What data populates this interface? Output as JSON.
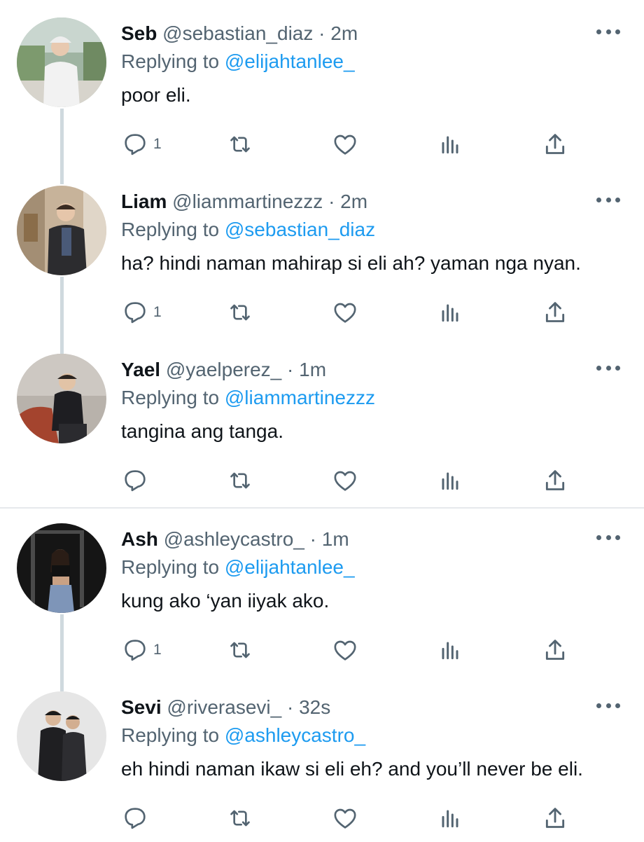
{
  "tweets": [
    {
      "name": "Seb",
      "handle": "@sebastian_diaz",
      "dot": "·",
      "time": "2m",
      "replying_prefix": "Replying to",
      "replying_handle": "@elijahtanlee_",
      "text": "poor eli.",
      "reply_count": "1",
      "avatar_icon": "profile-photo"
    },
    {
      "name": "Liam",
      "handle": "@liammartinezzz",
      "dot": "·",
      "time": "2m",
      "replying_prefix": "Replying to",
      "replying_handle": "@sebastian_diaz",
      "text": "ha? hindi naman mahirap si eli ah? yaman nga nyan.",
      "reply_count": "1",
      "avatar_icon": "profile-photo"
    },
    {
      "name": "Yael",
      "handle": "@yaelperez_",
      "dot": "·",
      "time": "1m",
      "replying_prefix": "Replying to",
      "replying_handle": "@liammartinezzz",
      "text": "tangina ang tanga.",
      "reply_count": "",
      "avatar_icon": "profile-photo"
    },
    {
      "name": "Ash",
      "handle": "@ashleycastro_",
      "dot": "·",
      "time": "1m",
      "replying_prefix": "Replying to",
      "replying_handle": "@elijahtanlee_",
      "text": "kung ako ‘yan iiyak ako.",
      "reply_count": "1",
      "avatar_icon": "profile-photo"
    },
    {
      "name": "Sevi",
      "handle": "@riverasevi_",
      "dot": "·",
      "time": "32s",
      "replying_prefix": "Replying to",
      "replying_handle": "@ashleycastro_",
      "text": "eh hindi naman ikaw si eli eh? and you’ll never be eli.",
      "reply_count": "",
      "avatar_icon": "profile-photo"
    }
  ],
  "icons": {
    "reply": "reply-icon",
    "retweet": "retweet-icon",
    "like": "heart-icon",
    "views": "views-icon",
    "share": "share-icon",
    "more": "more-icon"
  },
  "colors": {
    "text": "#0f1419",
    "secondary": "#536471",
    "link": "#1d9bf0",
    "thread_line": "#cfd9de",
    "divider": "#e6e9ec"
  }
}
